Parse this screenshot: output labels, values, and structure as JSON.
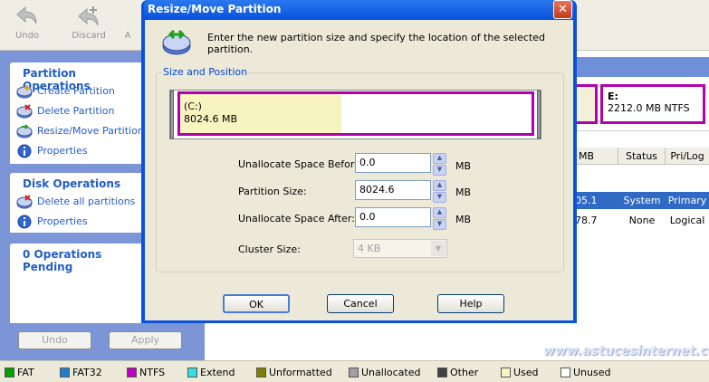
{
  "toolbar": {
    "undo_label": "Undo",
    "discard_label": "Discard",
    "apply_label_partial": "A"
  },
  "sidebar": {
    "partition_ops": {
      "title": "Partition Operations",
      "items": [
        {
          "label": "Create Partition",
          "icon": "create-partition-icon"
        },
        {
          "label": "Delete Partition",
          "icon": "delete-partition-icon"
        },
        {
          "label": "Resize/Move Partition",
          "icon": "resize-partition-icon"
        },
        {
          "label": "Properties",
          "icon": "info-icon"
        }
      ]
    },
    "disk_ops": {
      "title": "Disk Operations",
      "items": [
        {
          "label": "Delete all partitions",
          "icon": "delete-partition-icon"
        },
        {
          "label": "Properties",
          "icon": "info-icon"
        }
      ]
    },
    "pending_title": "0 Operations Pending",
    "undo_button": "Undo",
    "apply_button": "Apply"
  },
  "diskmap": {
    "e_label": "E:",
    "e_info": "2212.0 MB  NTFS"
  },
  "grid": {
    "headers": {
      "size_partial": "MB",
      "status": "Status",
      "prilog": "Pri/Log"
    },
    "rows": [
      {
        "size": "05.1",
        "status": "System",
        "type": "Primary"
      },
      {
        "size": "78.7",
        "status": "None",
        "type": "Logical"
      }
    ]
  },
  "dialog": {
    "title": "Resize/Move Partition",
    "close": "✕",
    "intro": "Enter the new partition size and specify the location of the selected partition.",
    "group_label": "Size and Position",
    "bar": {
      "drive": "(C:)",
      "size": "8024.6 MB",
      "used_fraction": 0.46
    },
    "fields": {
      "before_label": "Unallocate Space Before:",
      "before_value": "0.0",
      "size_label": "Partition Size:",
      "size_value": "8024.6",
      "after_label": "Unallocate Space After:",
      "after_value": "0.0",
      "unit": "MB",
      "cluster_label": "Cluster Size:",
      "cluster_value": "4 KB"
    },
    "buttons": {
      "ok": "OK",
      "cancel": "Cancel",
      "help": "Help"
    }
  },
  "legend": [
    {
      "label": "FAT",
      "color": "#00a000"
    },
    {
      "label": "FAT32",
      "color": "#2080d0"
    },
    {
      "label": "NTFS",
      "color": "#c000c0"
    },
    {
      "label": "Extend",
      "color": "#30e0e0"
    },
    {
      "label": "Unformatted",
      "color": "#808000"
    },
    {
      "label": "Unallocated",
      "color": "#a0a0a0"
    },
    {
      "label": "Other",
      "color": "#404040"
    },
    {
      "label": "Used",
      "color": "#f8f4c0"
    },
    {
      "label": "Unused",
      "color": "#ffffff"
    }
  ],
  "watermark": "www.astucesinternet.com"
}
